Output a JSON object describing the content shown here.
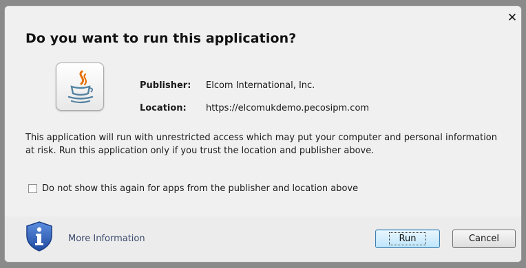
{
  "dialog": {
    "title": "Do you want to run this application?",
    "close_icon": "close-icon"
  },
  "app_icon": "java-icon",
  "info": {
    "publisher_label": "Publisher:",
    "publisher_value": "Elcom International, Inc.",
    "location_label": "Location:",
    "location_value": "https://elcomukdemo.pecosipm.com"
  },
  "warning_text": "This application will run with unrestricted access which may put your computer and personal information at risk. Run this application only if you trust the location and publisher above.",
  "checkbox": {
    "label": "Do not show this again for apps from the publisher and location above",
    "checked": false
  },
  "footer": {
    "info_icon": "shield-info-icon",
    "more_info_label": "More Information",
    "run_label": "Run",
    "cancel_label": "Cancel"
  },
  "colors": {
    "dialog_bg": "#f0f0f0",
    "link": "#3c4a6e",
    "shield_blue": "#2a5cb0"
  }
}
